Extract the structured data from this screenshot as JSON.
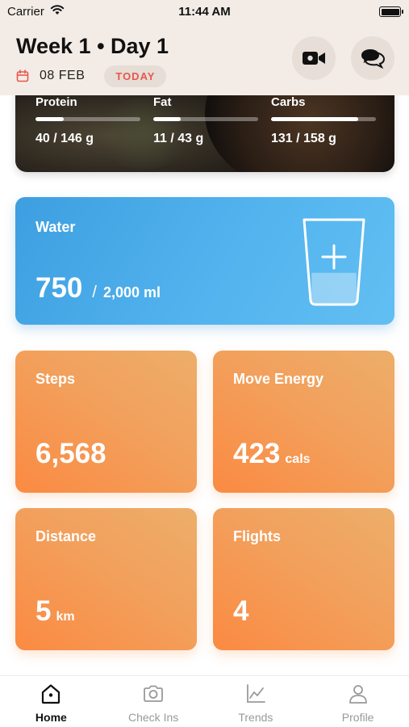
{
  "status_bar": {
    "carrier": "Carrier",
    "time": "11:44 AM"
  },
  "header": {
    "title": "Week 1 • Day 1",
    "date": "08 FEB",
    "today_label": "TODAY",
    "icons": [
      "calendar-icon",
      "video-camera-icon",
      "chat-bubbles-icon"
    ]
  },
  "macros": [
    {
      "label": "Protein",
      "value": "40 / 146 g",
      "progress": 0.27
    },
    {
      "label": "Fat",
      "value": "11 / 43 g",
      "progress": 0.26
    },
    {
      "label": "Carbs",
      "value": "131 / 158 g",
      "progress": 0.83
    }
  ],
  "water": {
    "label": "Water",
    "amount": "750",
    "separator": "/",
    "goal": "2,000 ml",
    "fill_fraction": 0.375,
    "icon": "water-glass-plus-icon"
  },
  "stats": {
    "steps": {
      "label": "Steps",
      "value": "6,568",
      "unit": ""
    },
    "energy": {
      "label": "Move Energy",
      "value": "423",
      "unit": "cals"
    },
    "distance": {
      "label": "Distance",
      "value": "5",
      "unit": "km"
    },
    "flights": {
      "label": "Flights",
      "value": "4",
      "unit": ""
    }
  },
  "tabs": [
    {
      "label": "Home",
      "icon": "home-icon",
      "active": true
    },
    {
      "label": "Check Ins",
      "icon": "camera-icon",
      "active": false
    },
    {
      "label": "Trends",
      "icon": "trend-chart-icon",
      "active": false
    },
    {
      "label": "Profile",
      "icon": "person-icon",
      "active": false
    }
  ],
  "colors": {
    "water_blue": "#4aaae9",
    "stat_orange": "#f59b55",
    "today_red": "#e8574e",
    "header_bg": "#f3ece6"
  }
}
